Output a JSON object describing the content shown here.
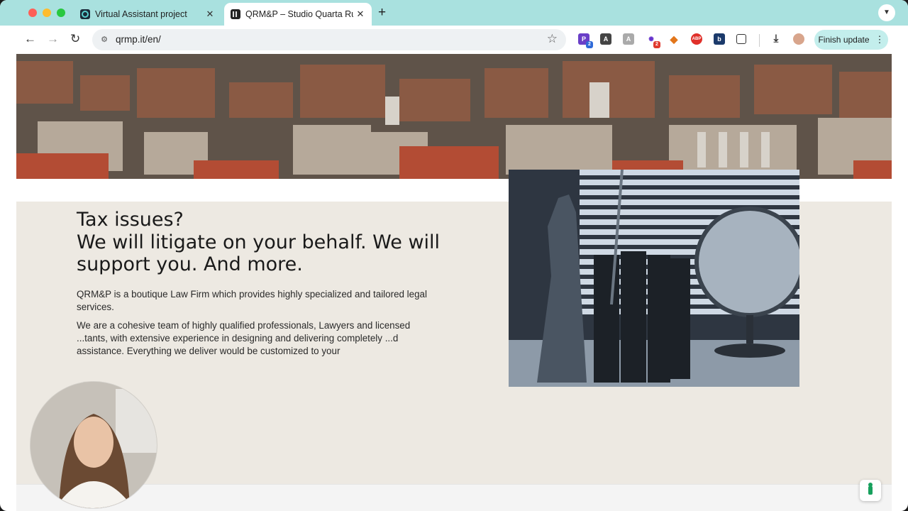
{
  "browser": {
    "tabs": [
      {
        "title": "Virtual Assistant project",
        "active": false
      },
      {
        "title": "QRM&P – Studio Quarta Rubi",
        "active": true
      }
    ],
    "url": "qrmp.it/en/",
    "finish_update_label": "Finish update",
    "extension_badges": {
      "ext1": "2",
      "ext4": "2"
    }
  },
  "page": {
    "heading_line1": "Tax issues?",
    "heading_line2": "We will litigate on your behalf. We will support you. And more.",
    "paragraph1": "QRM&P is a boutique Law Firm which provides highly specialized and tailored legal services.",
    "paragraph2": "We are a cohesive team of highly qualified professionals, Lawyers and licensed ...tants, with extensive experience in designing and delivering completely ...d assistance. Everything we deliver would be customized to your"
  },
  "colors": {
    "tab_bar": "#a9e1df",
    "section_bg": "#ede9e2",
    "finish_button": "#c3eeec"
  }
}
